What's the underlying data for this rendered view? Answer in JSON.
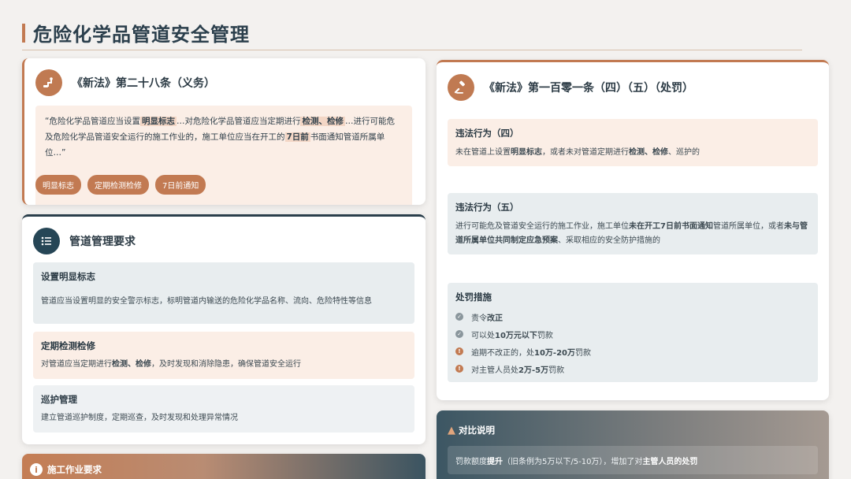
{
  "page_title": "危险化学品管道安全管理",
  "article28": {
    "title": "《新法》第二十八条（义务）",
    "quote": {
      "p1": "“危险化学品管道应当设置",
      "b1": "明显标志",
      "p2": "…对危险化学品管道应当定期进行",
      "b2": "检测、检修",
      "p3": "…进行可能危及危险化学品管道安全运行的施工作业的，施工单位应当在开工的",
      "b3": "7日前",
      "p4": "书面通知管道所属单位…”"
    },
    "tags": [
      "明显标志",
      "定期检测检修",
      "7日前通知"
    ]
  },
  "pipeline": {
    "title": "管道管理要求",
    "items": [
      {
        "heading": "设置明显标志",
        "desc": "管道应当设置明显的安全警示标志，标明管道内输送的危险化学品名称、流向、危险特性等信息"
      },
      {
        "heading": "定期检测检修",
        "desc_pre": "对管道应当定期进行",
        "desc_bold": "检测、检修",
        "desc_post": "，及时发现和消除隐患，确保管道安全运行"
      },
      {
        "heading": "巡护管理",
        "desc": "建立管道巡护制度，定期巡查，及时发现和处理异常情况"
      }
    ]
  },
  "construction": {
    "title": "施工作业要求"
  },
  "article101": {
    "title": "《新法》第一百零一条（四）（五）（处罚）",
    "violation4": {
      "heading": "违法行为（四）",
      "p1": "未在管道上设置",
      "b1": "明显标志",
      "p2": "，或者未对管道定期进行",
      "b2": "检测、检修",
      "p3": "、巡护的"
    },
    "violation5": {
      "heading": "违法行为（五）",
      "p1": "进行可能危及管道安全运行的施工作业，施工单位",
      "b1": "未在开工7日前书面通知",
      "p2": "管道所属单位，或者",
      "b2": "未与管道所属单位共同制定应急预案",
      "p3": "、采取相应的安全防护措施的"
    },
    "penalty": {
      "heading": "处罚措施",
      "rows": [
        {
          "pre": "责令",
          "bold": "改正",
          "post": ""
        },
        {
          "pre": "可以处",
          "bold": "10万元以下",
          "post": "罚款"
        },
        {
          "pre": "逾期不改正的，处",
          "bold": "10万-20万",
          "post": "罚款"
        },
        {
          "pre": "对主管人员处",
          "bold": "2万-5万",
          "post": "罚款"
        }
      ]
    }
  },
  "compare": {
    "title": "对比说明",
    "p1": "罚款额度",
    "b1": "提升",
    "p2": "（旧条例为5万以下/5-10万），增加了对",
    "b2": "主管人员的处罚"
  },
  "colors": {
    "accent": "#c27a52",
    "navy": "#264656"
  },
  "icons": [
    "pipe-icon",
    "list-icon",
    "info-icon",
    "gavel-icon",
    "check-circle-icon",
    "alert-circle-icon",
    "warning-icon"
  ]
}
